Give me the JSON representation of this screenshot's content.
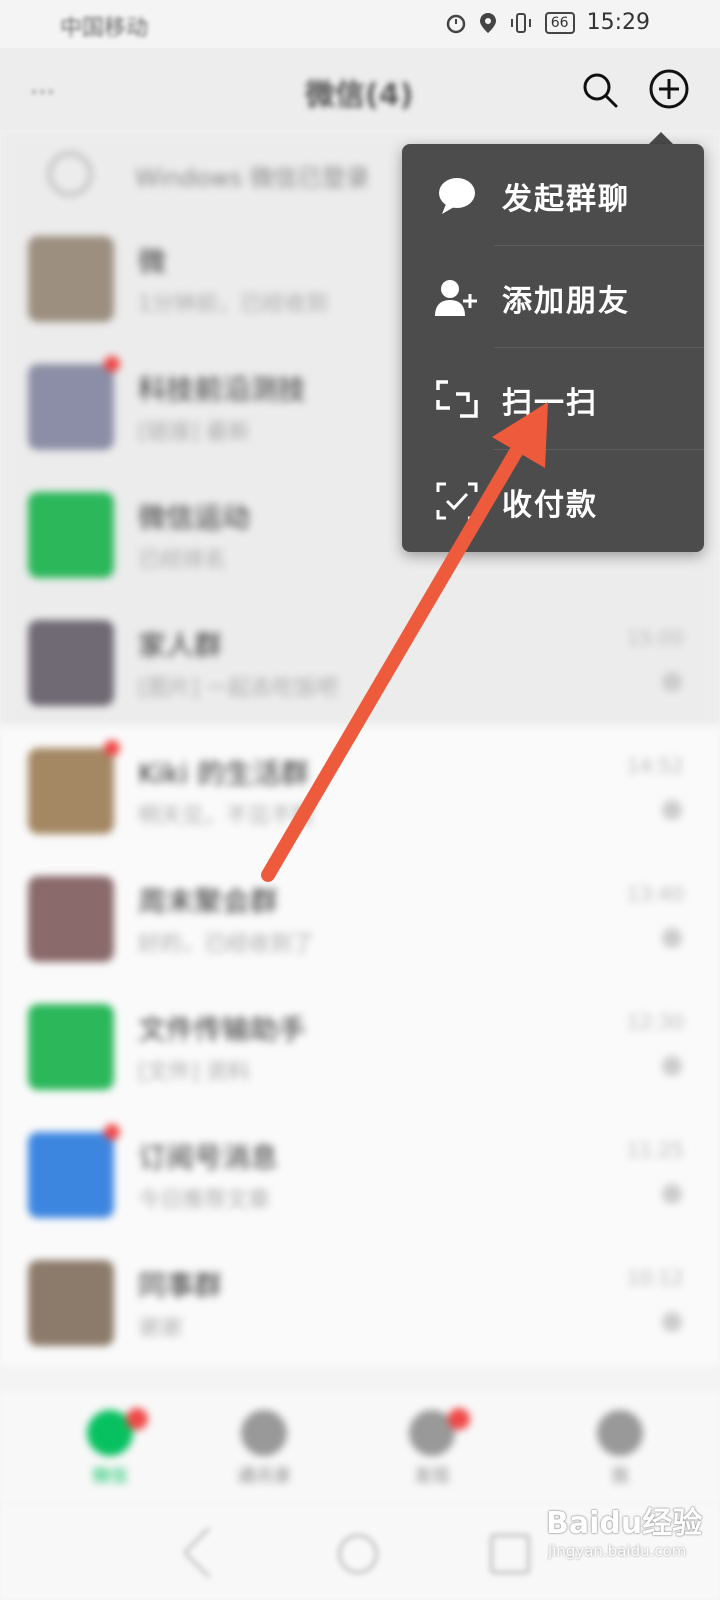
{
  "status_bar": {
    "carrier": "中国移动",
    "battery": "66",
    "time": "15:29"
  },
  "header": {
    "title": "微信(4)",
    "more_label": "···"
  },
  "windows_login": {
    "text": "Windows 微信已登录"
  },
  "chats": [
    {
      "name": "微",
      "preview": "1分钟前，已经收到",
      "time": "",
      "tone": "shade",
      "color": "#9c8f80",
      "dot": false
    },
    {
      "name": "科技前沿测技",
      "preview": "[链接] 最新",
      "time": "",
      "tone": "shade",
      "color": "#8b8ea6",
      "dot": true
    },
    {
      "name": "微信运动",
      "preview": "已经排名",
      "time": "",
      "tone": "shade",
      "color": "#2bb75a",
      "dot": false
    },
    {
      "name": "家人群",
      "preview": "[图片] 一起去吃饭吧",
      "time": "15:00",
      "tone": "shade",
      "color": "#6f6a73",
      "dot": false
    },
    {
      "name": "Kiki 的生活群",
      "preview": "明天见，不见不散",
      "time": "14:52",
      "tone": "light",
      "color": "#a48763",
      "dot": true
    },
    {
      "name": "周末聚会群",
      "preview": "好的，已经收到了",
      "time": "13:40",
      "tone": "light",
      "color": "#8a6a6a",
      "dot": false
    },
    {
      "name": "文件传输助手",
      "preview": "[文件] 资料",
      "time": "12:30",
      "tone": "light",
      "color": "#2bb75a",
      "dot": false
    },
    {
      "name": "订阅号消息",
      "preview": "今日推荐文章",
      "time": "11:25",
      "tone": "light",
      "color": "#3d86e0",
      "dot": true
    },
    {
      "name": "同事群",
      "preview": "谢谢",
      "time": "10:12",
      "tone": "light",
      "color": "#8c7b6b",
      "dot": false
    }
  ],
  "bottom_nav": [
    {
      "label": "微信",
      "active": true,
      "badge": true
    },
    {
      "label": "通讯录",
      "active": false,
      "badge": false
    },
    {
      "label": "发现",
      "active": false,
      "badge": true
    },
    {
      "label": "我",
      "active": false,
      "badge": false
    }
  ],
  "menu": {
    "items": [
      {
        "label": "发起群聊",
        "icon": "chat-bubble-icon"
      },
      {
        "label": "添加朋友",
        "icon": "add-friend-icon"
      },
      {
        "label": "扫一扫",
        "icon": "scan-icon"
      },
      {
        "label": "收付款",
        "icon": "payment-icon"
      }
    ]
  },
  "watermark": {
    "main": "Baidu经验",
    "sub": "jingyan.baidu.com"
  },
  "colors": {
    "menu_bg": "#4c4c4c",
    "accent_green": "#07c160",
    "arrow": "#ee5a3c"
  }
}
